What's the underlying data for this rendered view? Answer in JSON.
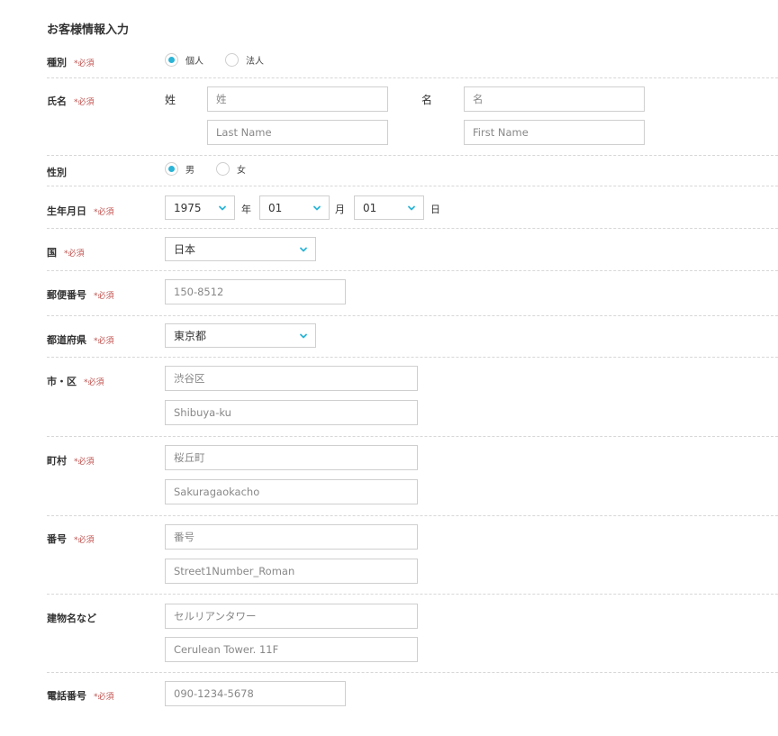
{
  "title": "お客様情報入力",
  "required_mark": "*必須",
  "accent_color": "#2bb4d6",
  "required_color": "#c0504d",
  "fields": {
    "type": {
      "label": "種別",
      "options": [
        "個人",
        "法人"
      ],
      "selected": "個人"
    },
    "name": {
      "label": "氏名",
      "last_label": "姓",
      "first_label": "名",
      "last_placeholder": "姓",
      "first_placeholder": "名",
      "last_roman_placeholder": "Last Name",
      "first_roman_placeholder": "First Name"
    },
    "gender": {
      "label": "性別",
      "options": [
        "男",
        "女"
      ],
      "selected": "男"
    },
    "birthdate": {
      "label": "生年月日",
      "year": "1975",
      "year_unit": "年",
      "month": "01",
      "month_unit": "月",
      "day": "01",
      "day_unit": "日",
      "chevron_icon": "chevron-down-icon"
    },
    "country": {
      "label": "国",
      "value": "日本"
    },
    "postal": {
      "label": "郵便番号",
      "placeholder": "150-8512"
    },
    "prefecture": {
      "label": "都道府県",
      "value": "東京都"
    },
    "city": {
      "label": "市・区",
      "placeholder": "渋谷区",
      "roman_placeholder": "Shibuya-ku"
    },
    "town": {
      "label": "町村",
      "placeholder": "桜丘町",
      "roman_placeholder": "Sakuragaokacho"
    },
    "street": {
      "label": "番号",
      "placeholder": "番号",
      "roman_placeholder": "Street1Number_Roman"
    },
    "building": {
      "label": "建物名など",
      "placeholder": "セルリアンタワー",
      "roman_placeholder": "Cerulean Tower. 11F"
    },
    "phone": {
      "label": "電話番号",
      "placeholder": "090-1234-5678"
    }
  }
}
